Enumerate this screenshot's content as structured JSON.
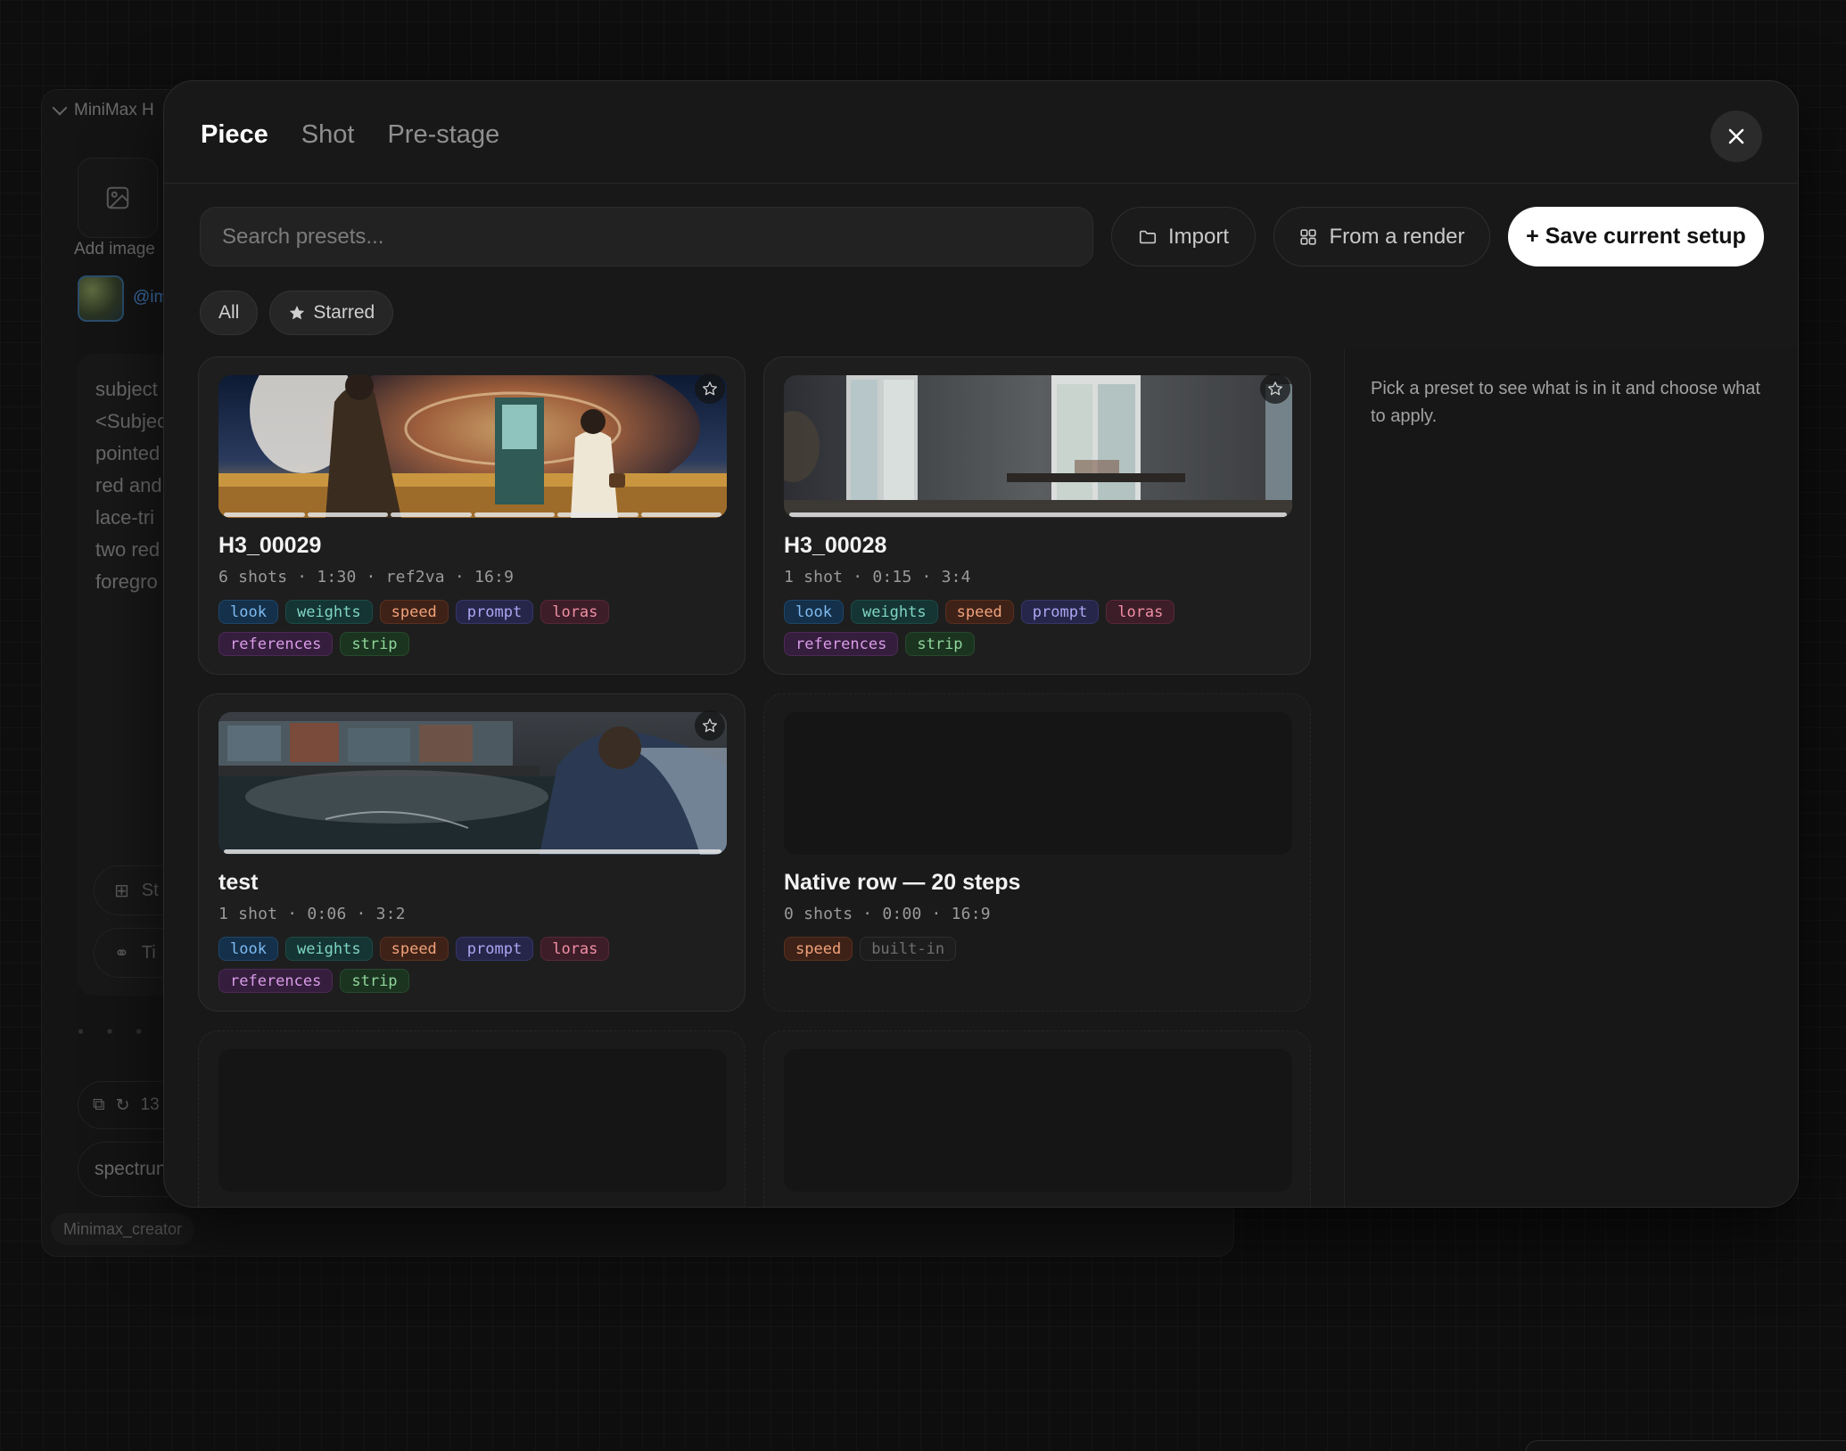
{
  "background": {
    "node_title": "MiniMax H",
    "add_image_label": "Add image",
    "handle": "@im",
    "prompt_lines": [
      "subject",
      "<Subjec",
      "pointed",
      "red and",
      "lace-tri",
      "two red",
      "foregro"
    ],
    "button_1": "St",
    "button_2": "Ti",
    "counter": "13",
    "spectrum_label": "spectrun",
    "node_tag": "Minimax_creator"
  },
  "tabs": [
    {
      "label": "Piece",
      "active": true
    },
    {
      "label": "Shot",
      "active": false
    },
    {
      "label": "Pre-stage",
      "active": false
    }
  ],
  "toolbar": {
    "search_placeholder": "Search presets...",
    "import_label": "Import",
    "from_render_label": "From a render",
    "save_label": "+ Save current setup"
  },
  "filters": {
    "all_label": "All",
    "starred_label": "Starred"
  },
  "side_pane": {
    "message": "Pick a preset to see what is in it and choose what to apply."
  },
  "presets": [
    {
      "title": "H3_00029",
      "meta": "6 shots · 1:30 · ref2va · 16:9",
      "tags": [
        "look",
        "weights",
        "speed",
        "prompt",
        "loras",
        "references",
        "strip"
      ],
      "segments": 6
    },
    {
      "title": "H3_00028",
      "meta": "1 shot · 0:15 · 3:4",
      "tags": [
        "look",
        "weights",
        "speed",
        "prompt",
        "loras",
        "references",
        "strip"
      ],
      "segments": 1
    },
    {
      "title": "test",
      "meta": "1 shot · 0:06 · 3:2",
      "tags": [
        "look",
        "weights",
        "speed",
        "prompt",
        "loras",
        "references",
        "strip"
      ],
      "segments": 1
    },
    {
      "title": "Native row — 20 steps",
      "meta": "0 shots · 0:00 · 16:9",
      "tags": [
        "speed",
        "built-in"
      ],
      "segments": 0
    }
  ],
  "colors": {
    "accent_white": "#ffffff",
    "modal_bg": "#181818",
    "tag_look": "#7fbaf0",
    "tag_weights": "#7fd4c6",
    "tag_speed": "#f2a27a",
    "tag_prompt": "#aaa6f3",
    "tag_loras": "#f08fa4",
    "tag_references": "#d99be8",
    "tag_strip": "#8fd69a"
  },
  "icons": [
    "close-icon",
    "folder-icon",
    "grid-icon",
    "star-icon",
    "image-icon",
    "chevron-down-icon"
  ]
}
